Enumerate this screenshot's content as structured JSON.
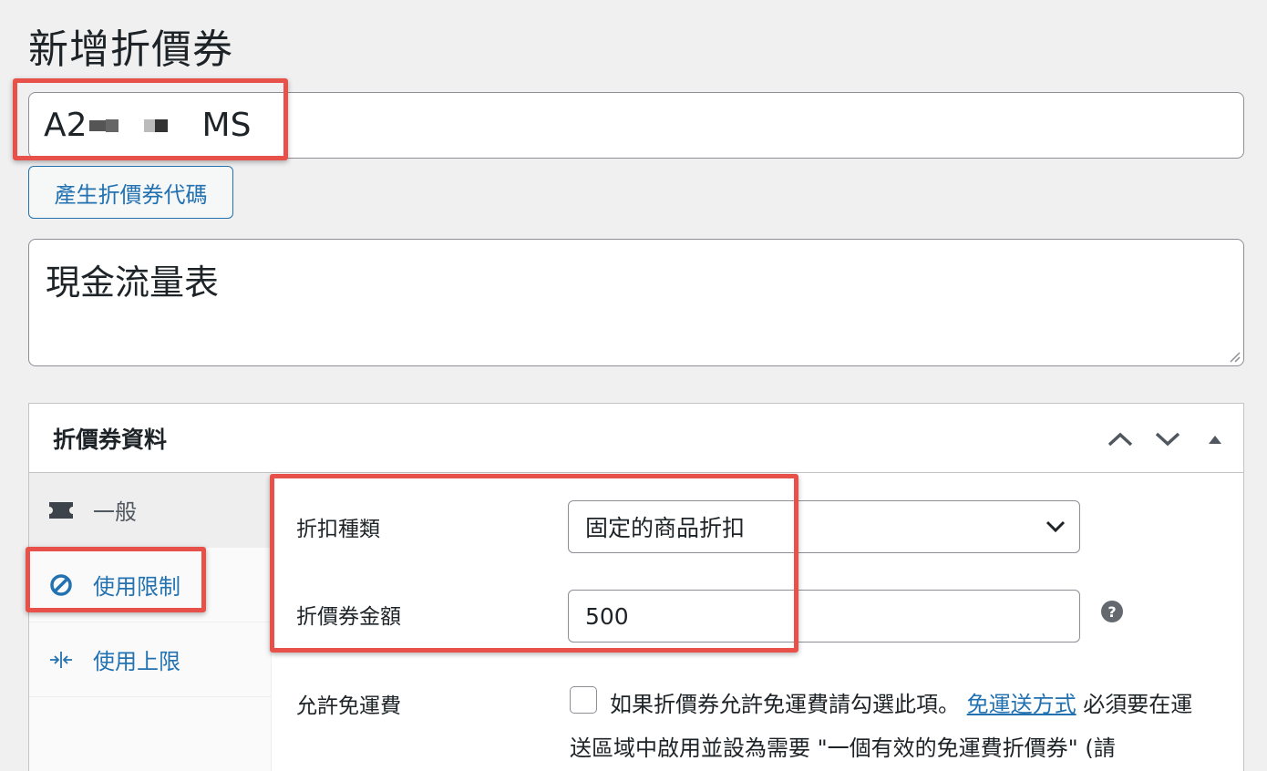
{
  "page": {
    "title": "新增折價券"
  },
  "coupon": {
    "code_start": "A2",
    "code_end": "MS"
  },
  "buttons": {
    "generate_code": "產生折價券代碼"
  },
  "description": {
    "value": "現金流量表"
  },
  "panel": {
    "title": "折價券資料",
    "controls": [
      "chevron-up-icon",
      "chevron-down-icon",
      "triangle-up-icon"
    ]
  },
  "tabs": [
    {
      "label": "一般",
      "icon": "ticket-icon"
    },
    {
      "label": "使用限制",
      "icon": "prohibited-icon"
    },
    {
      "label": "使用上限",
      "icon": "arrows-in-icon"
    }
  ],
  "fields": {
    "discount_type": {
      "label": "折扣種類",
      "value": "固定的商品折扣"
    },
    "amount": {
      "label": "折價券金額",
      "value": "500"
    },
    "free_shipping": {
      "label": "允許免運費",
      "text_before": "如果折價券允許免運費請勾選此項。",
      "link": "免運送方式",
      "text_after": "必須要在運送區域中啟用並設為需要 \"一個有效的免運費折價券\" (請"
    }
  },
  "colors": {
    "highlight": "#e8514a",
    "link": "#2271b1",
    "background": "#f0f0f1"
  }
}
